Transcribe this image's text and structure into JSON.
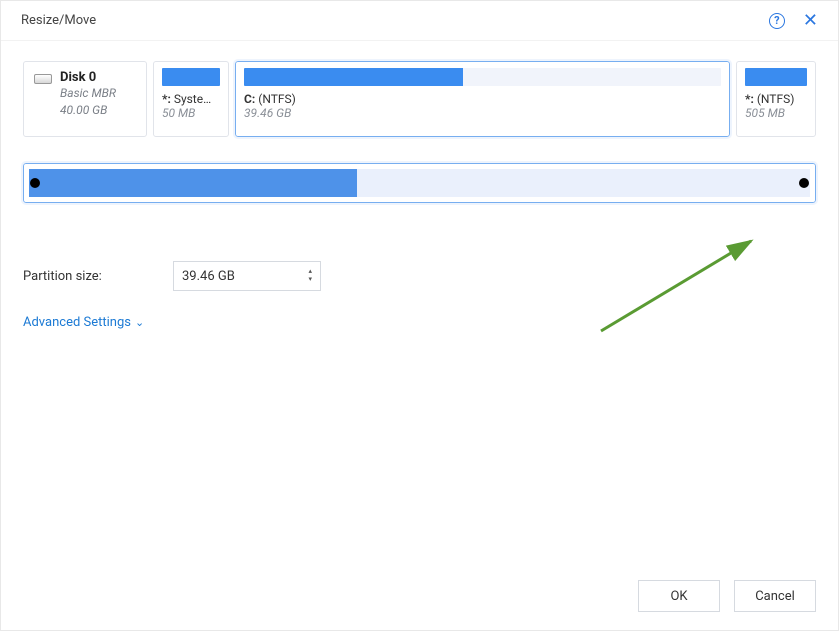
{
  "dialog": {
    "title": "Resize/Move"
  },
  "disk": {
    "name": "Disk 0",
    "type": "Basic MBR",
    "size": "40.00 GB"
  },
  "partitions": [
    {
      "drive": "*: ",
      "fs": "System...",
      "size": "50 MB",
      "fillPct": "100%",
      "selected": false
    },
    {
      "drive": "C: ",
      "fs": "(NTFS)",
      "size": "39.46 GB",
      "fillPct": "46%",
      "selected": true
    },
    {
      "drive": "*: ",
      "fs": "(NTFS)",
      "size": "505 MB",
      "fillPct": "100%",
      "selected": false
    }
  ],
  "fields": {
    "partitionSizeLabel": "Partition size:",
    "partitionSizeValue": "39.46 GB"
  },
  "advanced": {
    "label": "Advanced Settings"
  },
  "buttons": {
    "ok": "OK",
    "cancel": "Cancel"
  },
  "icons": {
    "help": "?",
    "close": "✕",
    "chevDown": "⌄",
    "up": "▴",
    "down": "▾"
  }
}
